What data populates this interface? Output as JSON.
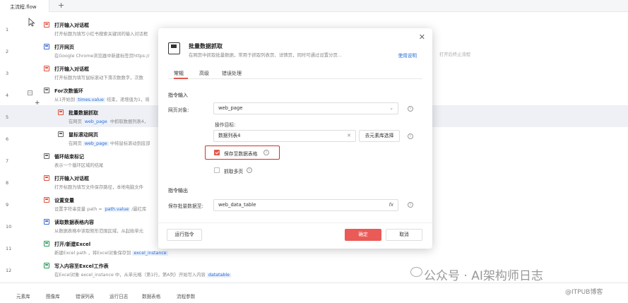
{
  "tab": {
    "title": "主流程.flow",
    "add_label": "+"
  },
  "rows": [
    {
      "num": "1",
      "title": "打开输入对话框",
      "desc": "打开标题为填写小红书搜索关键词的输入对话框",
      "icon": "dialog-icon"
    },
    {
      "num": "2",
      "title": "打开网页",
      "desc": "在Google Chrome浏览器中新建标签页https://",
      "icon": "web-icon"
    },
    {
      "num": "3",
      "title": "打开输入对话框",
      "desc": "打开标题为填写鼠标滚动下滑次数数字，次数",
      "icon": "dialog-icon"
    },
    {
      "num": "4",
      "title": "For次数循环",
      "desc_pre": "从1开始到",
      "desc_code": "times.value",
      "desc_post": "结束，递增值为1，将",
      "icon": "loop-icon"
    },
    {
      "num": "5",
      "title": "批量数据抓取",
      "desc_pre": "在网页",
      "desc_code": "web_page",
      "desc_post": "中抓取数据列表4，",
      "icon": "grab-icon"
    },
    {
      "num": "6",
      "title": "鼠标滚动网页",
      "desc_pre": "在网页",
      "desc_code": "web_page",
      "desc_post": "中将鼠标滚动到底部",
      "icon": "scroll-icon"
    },
    {
      "num": "7",
      "title": "循环结束标记",
      "desc": "表示一个循环区域的结尾",
      "icon": "loop-end-icon"
    },
    {
      "num": "8",
      "title": "打开输入对话框",
      "desc": "打开标题为填写文件保存路径，本地电脑文件",
      "icon": "dialog-icon"
    },
    {
      "num": "9",
      "title": "设置变量",
      "desc_pre": "设置字符串变量 path = ",
      "desc_code": "path.value",
      "desc_post": "/最红库",
      "icon": "variable-icon"
    },
    {
      "num": "10",
      "title": "读取数据表格内容",
      "desc": "从数据表格中读取矩形范围区域，从起始单元",
      "icon": "table-read-icon"
    },
    {
      "num": "11",
      "title": "打开/新建Excel",
      "desc_pre": "新建Excel  path ，将Excel对象保存到",
      "desc_code": "excel_instance",
      "desc_post": "",
      "icon": "excel-icon"
    },
    {
      "num": "12",
      "title": "写入内容至Excel工作表",
      "desc_pre": "在Excel对象 excel_instance 中，从单元格（第1行，第A列）开始写入内容",
      "desc_code": "datatable",
      "desc_post": "",
      "icon": "excel-write-icon"
    }
  ],
  "ghost_text": "打开后终止流程",
  "dialog": {
    "title": "批量数据抓取",
    "subtitle": "在网页中抓取批量数据，常用于抓取列表页、详情页，同时可通过设置分页...",
    "help": "使用说明",
    "tabs": [
      "常规",
      "高级",
      "错误处理"
    ],
    "section_input": "指令输入",
    "page_label": "网页对象:",
    "page_value": "web_page",
    "target_label": "操作目标:",
    "target_value": "数据列表4",
    "element_button": "去元素库选择",
    "save_checkbox": "保存至数据表格",
    "pagination_checkbox": "抓取多页",
    "section_output": "指令输出",
    "output_label": "保存批量数据至:",
    "output_value": "web_data_table",
    "fx": "fx",
    "run_button": "运行指令",
    "ok_button": "确定",
    "cancel_button": "取消"
  },
  "bottom_tabs": [
    "元素库",
    "图像库",
    "错误列表",
    "运行日志",
    "数据表格",
    "流程参数"
  ],
  "watermark": {
    "main": "公众号 · AI架构师日志",
    "sub": "@ITPUB博客"
  }
}
